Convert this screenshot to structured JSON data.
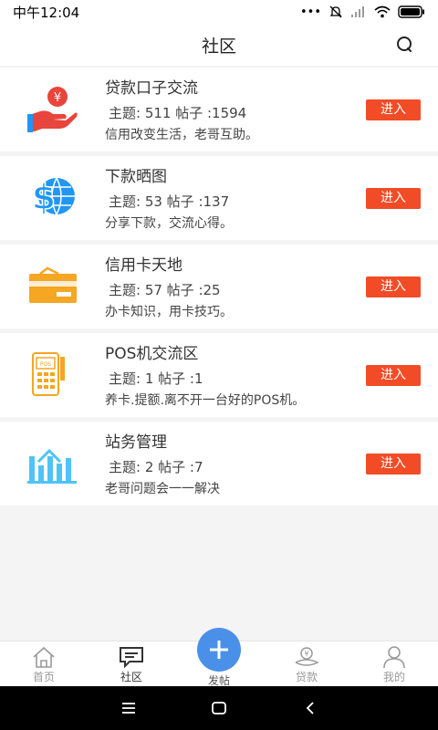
{
  "status": {
    "time": "中午12:04",
    "dots": "•••"
  },
  "header": {
    "title": "社区"
  },
  "forums": [
    {
      "name": "贷款口子交流",
      "stats": "主题: 511 帖子 :1594",
      "desc": "信用改变生活，老哥互助。",
      "button": "进入",
      "icon": "loan-hand-icon"
    },
    {
      "name": "下款晒图",
      "stats": "主题: 53 帖子 :137",
      "desc": "分享下款，交流心得。",
      "button": "进入",
      "icon": "dollar-globe-icon"
    },
    {
      "name": "信用卡天地",
      "stats": "主题: 57 帖子 :25",
      "desc": "办卡知识，用卡技巧。",
      "button": "进入",
      "icon": "credit-card-icon"
    },
    {
      "name": "POS机交流区",
      "stats": "主题: 1 帖子 :1",
      "desc": "养卡.提额.离不开一台好的POS机。",
      "button": "进入",
      "icon": "pos-machine-icon"
    },
    {
      "name": "站务管理",
      "stats": "主题: 2 帖子 :7",
      "desc": "老哥问题会一一解决",
      "button": "进入",
      "icon": "chart-house-icon"
    }
  ],
  "tabs": {
    "home": "首页",
    "community": "社区",
    "post": "发帖",
    "loan": "贷款",
    "mine": "我的",
    "active": "社区"
  },
  "colors": {
    "accent": "#f14c26",
    "post_button": "#4a90e8",
    "icon_orange": "#f5a623",
    "icon_blue": "#2196f3"
  }
}
